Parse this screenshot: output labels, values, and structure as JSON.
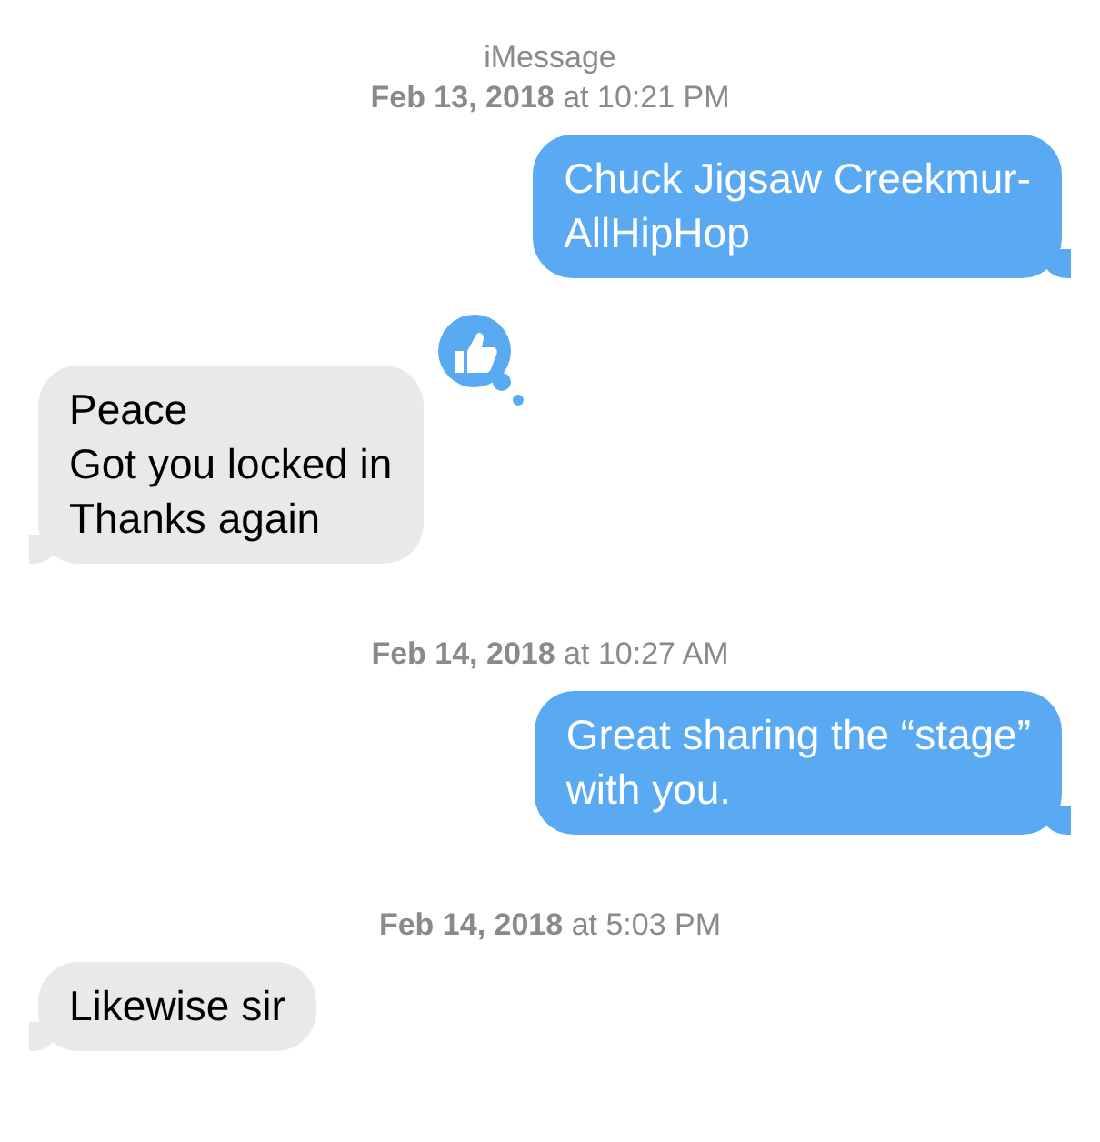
{
  "service": "iMessage",
  "items": [
    {
      "kind": "timestamp",
      "text": "**Feb 13, 2018** at 10:21 PM"
    },
    {
      "kind": "sent",
      "lines": [
        "Chuck Jigsaw Creekmur-",
        "AllHipHop"
      ]
    },
    {
      "kind": "received",
      "lines": [
        "Peace",
        "Got you locked in",
        "Thanks again"
      ],
      "tapback": true
    },
    {
      "kind": "timestamp",
      "text": "**Feb 14, 2018** at 10:27 AM"
    },
    {
      "kind": "sent",
      "lines": [
        "Great sharing the “stage”",
        "with you."
      ]
    },
    {
      "kind": "timestamp",
      "text": "**Feb 14, 2018** at 5:03 PM"
    },
    {
      "kind": "received",
      "lines": [
        "Likewise sir"
      ]
    }
  ]
}
